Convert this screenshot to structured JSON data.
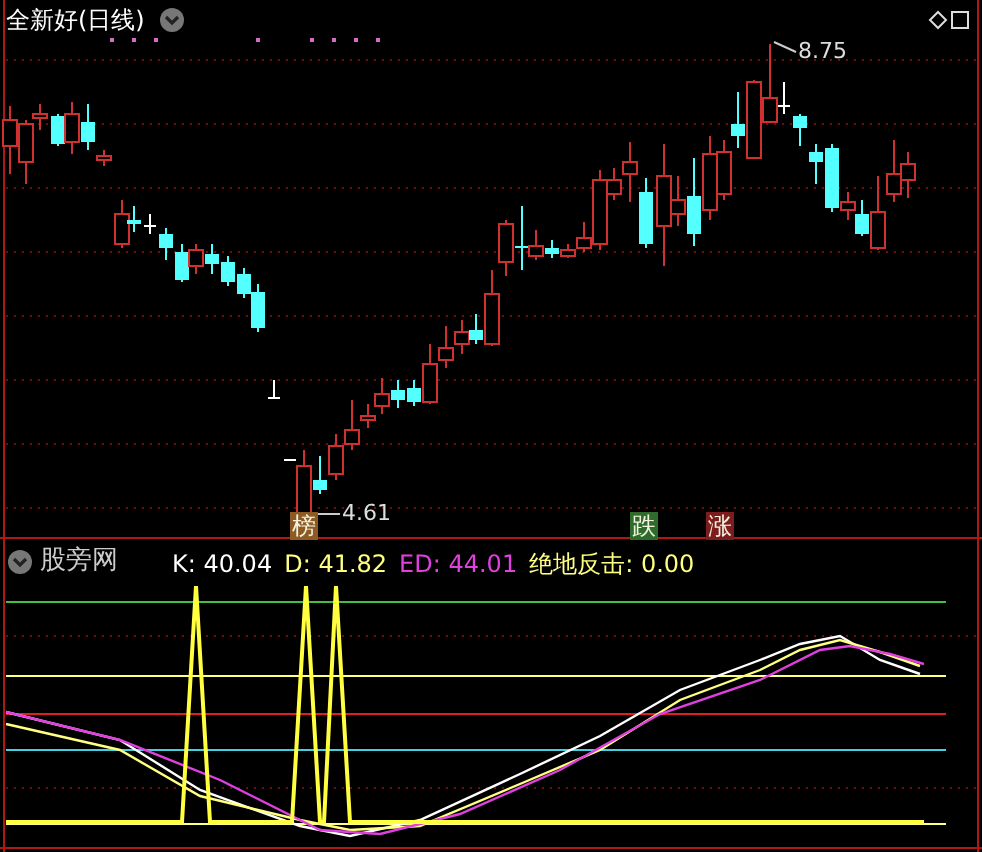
{
  "header": {
    "title": "全新好(日线)"
  },
  "price_labels": [
    {
      "kind": "high",
      "text": "8.75"
    },
    {
      "kind": "low",
      "text": "4.61"
    }
  ],
  "signals": [
    {
      "text": "榜",
      "color": "#8c5a22"
    },
    {
      "text": "跌",
      "color": "#2f6b2a"
    },
    {
      "text": "涨",
      "color": "#7c1c1c"
    }
  ],
  "indicator_panel": {
    "name": "股旁网",
    "values": [
      {
        "label": "K: 40.04",
        "color": "#ffffff"
      },
      {
        "label": "D: 41.82",
        "color": "#ffff80"
      },
      {
        "label": "ED: 44.01",
        "color": "#e040e0"
      },
      {
        "label": "绝地反击: 0.00",
        "color": "#ffff80"
      }
    ]
  }
}
